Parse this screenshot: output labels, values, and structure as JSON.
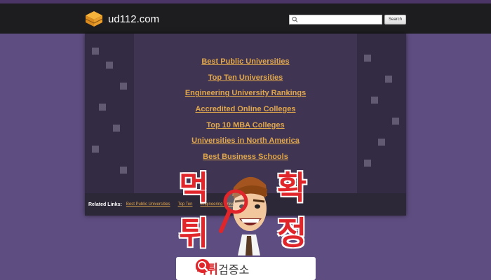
{
  "header": {
    "site_name": "ud112.com",
    "search_placeholder": "",
    "search_button": "Search"
  },
  "main_links": [
    "Best Public Universities",
    "Top Ten Universities",
    "Engineering University Rankings",
    "Accredited Online Colleges",
    "Top 10 MBA Colleges",
    "Universities in North America",
    "Best Business Schools"
  ],
  "related": {
    "title": "Related Links:",
    "links": [
      "Best Public Universities",
      "Top Ten",
      "Engineering University Rankings"
    ]
  },
  "overlay": {
    "chars": [
      "먹",
      "확",
      "튀",
      "정"
    ],
    "banner_red": "먹튀",
    "banner_dark": "검증소"
  },
  "colors": {
    "background": "#5e4d80",
    "topbar": "#1d1d1f",
    "panel": "#3f3553",
    "link": "#e0a64b",
    "accent_red": "#e0262b"
  },
  "icons": [
    "logo-cube-icon",
    "search-icon",
    "magnifier-icon"
  ]
}
